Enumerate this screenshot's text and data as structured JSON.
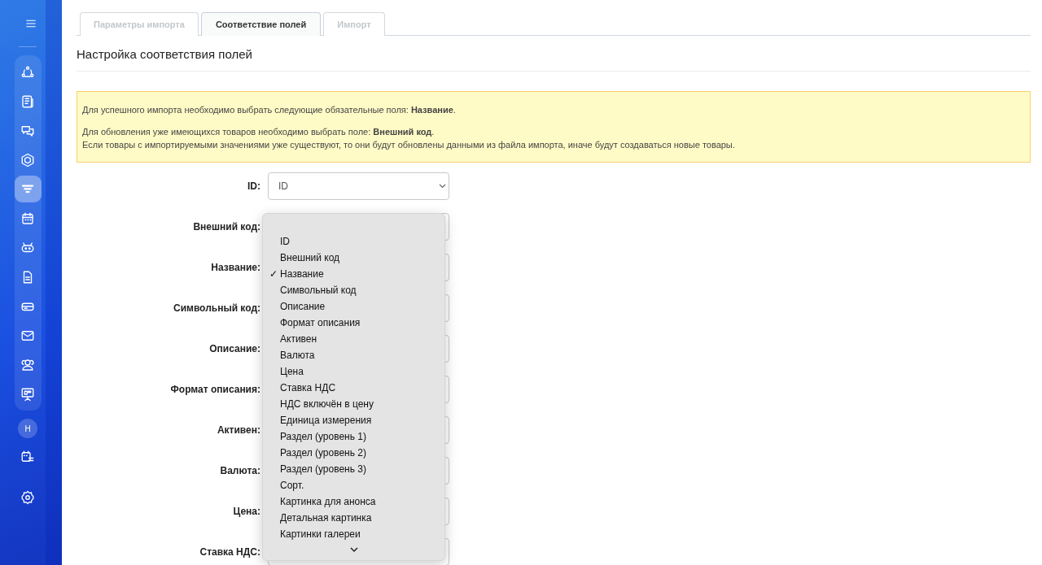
{
  "sidebar": {
    "items": [
      {
        "selected": false
      },
      {
        "selected": false
      },
      {
        "selected": false
      },
      {
        "selected": false
      },
      {
        "selected": true
      },
      {
        "selected": false
      },
      {
        "selected": false
      },
      {
        "selected": false
      },
      {
        "selected": false
      },
      {
        "selected": false
      },
      {
        "selected": false
      },
      {
        "selected": false
      }
    ],
    "avatar": "Н"
  },
  "tabs": [
    {
      "label": "Параметры импорта",
      "selected": false
    },
    {
      "label": "Соответствие полей",
      "selected": true
    },
    {
      "label": "Импорт",
      "selected": false
    }
  ],
  "heading": "Настройка соответствия полей",
  "alert": {
    "lines": [
      "Для успешного импорта необходимо выбрать следующие обязательные поля: **Название**.",
      "Для обновления уже имеющихся товаров необходимо выбрать поле: **Внешний код**.",
      "Если товары с импортируемыми значениями уже существуют, то они будут обновлены данными из файла импорта, иначе будут создаваться новые товары."
    ]
  },
  "fields": [
    {
      "label": "ID:",
      "value": "ID"
    },
    {
      "label": "Внешний код:"
    },
    {
      "label": "Название:"
    },
    {
      "label": "Символьный код:"
    },
    {
      "label": "Описание:"
    },
    {
      "label": "Формат описания:"
    },
    {
      "label": "Активен:"
    },
    {
      "label": "Валюта:"
    },
    {
      "label": "Цена:"
    },
    {
      "label": "Ставка НДС:"
    }
  ],
  "dropdown": {
    "options": [
      {
        "label": "ID",
        "selected": false
      },
      {
        "label": "Внешний код",
        "selected": false
      },
      {
        "label": "Название",
        "selected": true
      },
      {
        "label": "Символьный код",
        "selected": false
      },
      {
        "label": "Описание",
        "selected": false
      },
      {
        "label": "Формат описания",
        "selected": false
      },
      {
        "label": "Активен",
        "selected": false
      },
      {
        "label": "Валюта",
        "selected": false
      },
      {
        "label": "Цена",
        "selected": false
      },
      {
        "label": "Ставка НДС",
        "selected": false
      },
      {
        "label": "НДС включён в цену",
        "selected": false
      },
      {
        "label": "Единица измерения",
        "selected": false
      },
      {
        "label": "Раздел (уровень 1)",
        "selected": false
      },
      {
        "label": "Раздел (уровень 2)",
        "selected": false
      },
      {
        "label": "Раздел (уровень 3)",
        "selected": false
      },
      {
        "label": "Сорт.",
        "selected": false
      },
      {
        "label": "Картинка для анонса",
        "selected": false
      },
      {
        "label": "Детальная картинка",
        "selected": false
      },
      {
        "label": "Картинки галереи",
        "selected": false
      }
    ],
    "check_mark": "✓"
  }
}
